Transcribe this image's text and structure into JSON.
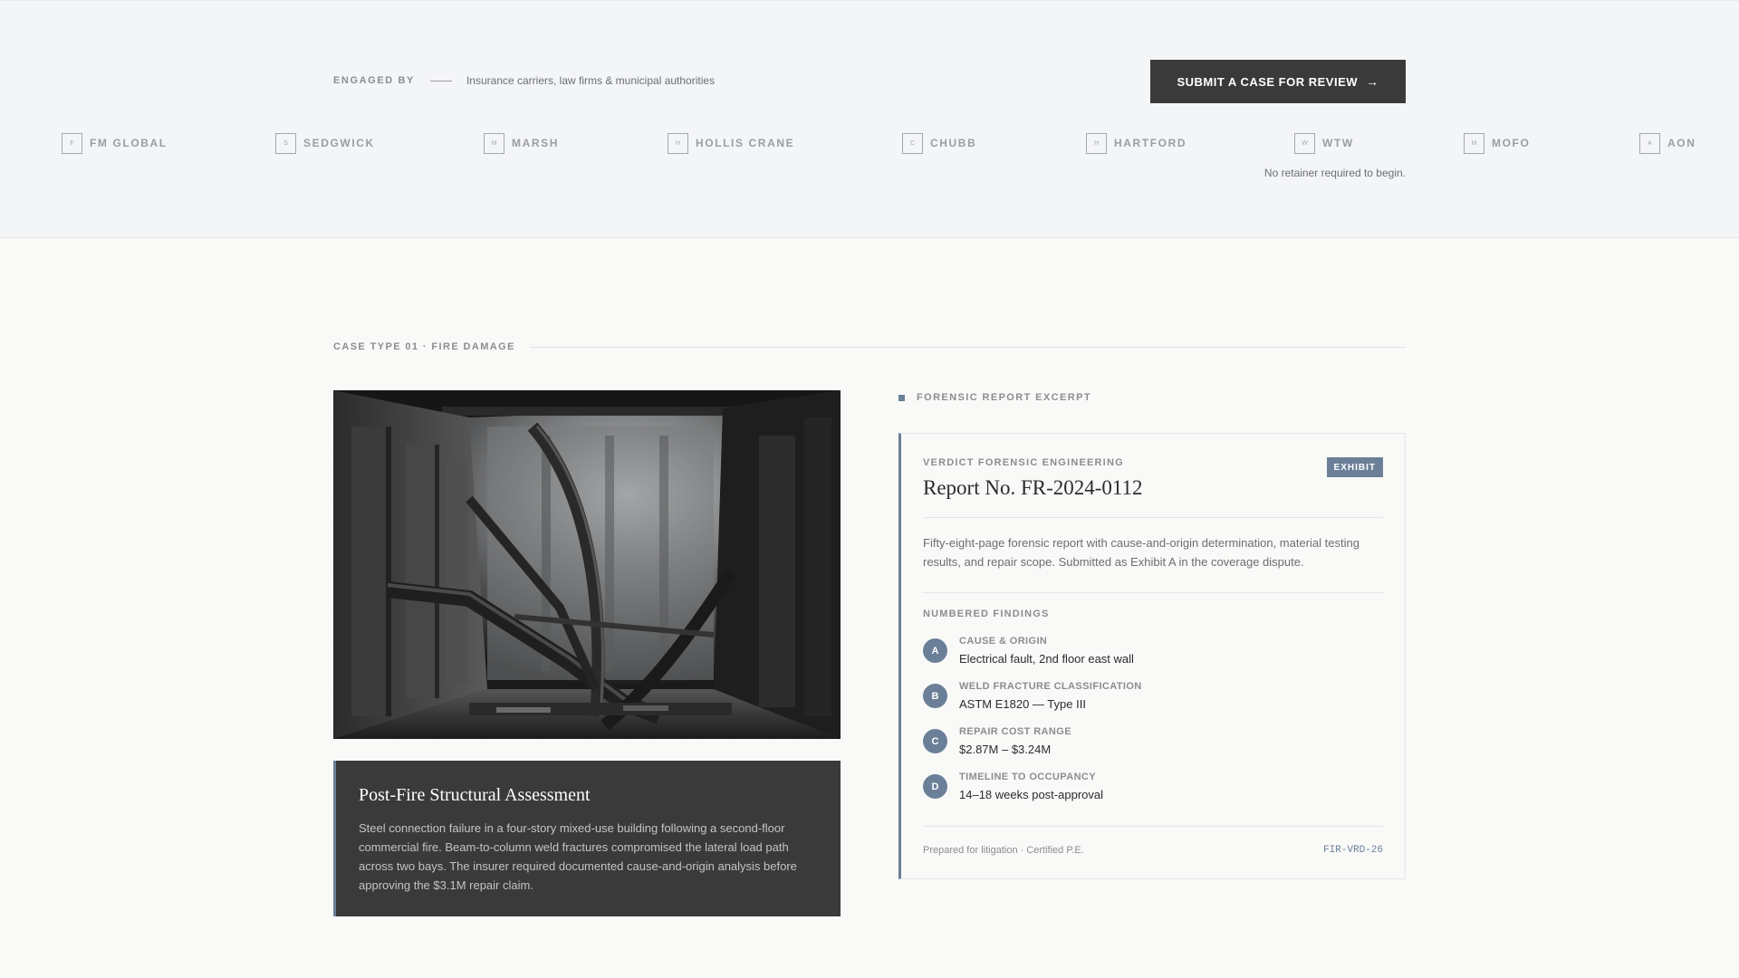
{
  "header": {
    "engaged_label": "ENGAGED BY",
    "engaged_text": "Insurance carriers, law firms & municipal authorities",
    "cta_label": "SUBMIT A CASE FOR REVIEW",
    "cta_icon": "arrow-right-icon",
    "retainer_note": "No retainer required to begin."
  },
  "clients": [
    {
      "mono": "F",
      "name": "FM GLOBAL"
    },
    {
      "mono": "S",
      "name": "SEDGWICK"
    },
    {
      "mono": "M",
      "name": "MARSH"
    },
    {
      "mono": "H",
      "name": "HOLLIS CRANE"
    },
    {
      "mono": "C",
      "name": "CHUBB"
    },
    {
      "mono": "H",
      "name": "HARTFORD"
    },
    {
      "mono": "W",
      "name": "WTW"
    },
    {
      "mono": "M",
      "name": "MOFO"
    },
    {
      "mono": "A",
      "name": "AON"
    }
  ],
  "case": {
    "label": "CASE TYPE 01 · FIRE DAMAGE",
    "title": "Post-Fire Structural Assessment",
    "body": "Steel connection failure in a four-story mixed-use building following a second-floor commercial fire. Beam-to-column weld fractures compromised the lateral load path across two bays. The insurer required documented cause-and-origin analysis before approving the $3.1M repair claim."
  },
  "report": {
    "excerpt_label": "FORENSIC REPORT EXCERPT",
    "firm": "VERDICT FORENSIC ENGINEERING",
    "number": "Report No. FR-2024-0112",
    "badge": "EXHIBIT",
    "summary": "Fifty-eight-page forensic report with cause-and-origin determination, material testing results, and repair scope. Submitted as Exhibit A in the coverage dispute.",
    "findings_label": "NUMBERED FINDINGS",
    "findings": [
      {
        "letter": "A",
        "caption": "CAUSE & ORIGIN",
        "value": "Electrical fault, 2nd floor east wall"
      },
      {
        "letter": "B",
        "caption": "WELD FRACTURE CLASSIFICATION",
        "value": "ASTM E1820 — Type III"
      },
      {
        "letter": "C",
        "caption": "REPAIR COST RANGE",
        "value": "$2.87M – $3.24M"
      },
      {
        "letter": "D",
        "caption": "TIMELINE TO OCCUPANCY",
        "value": "14–18 weeks post-approval"
      }
    ],
    "prepared": "Prepared for litigation · Certified P.E.",
    "code": "FIR-VRD-26"
  },
  "colors": {
    "accent": "#6b8098",
    "dark": "#3a3a3a",
    "band": "#f4f5f7",
    "page": "#f9f9f7"
  }
}
